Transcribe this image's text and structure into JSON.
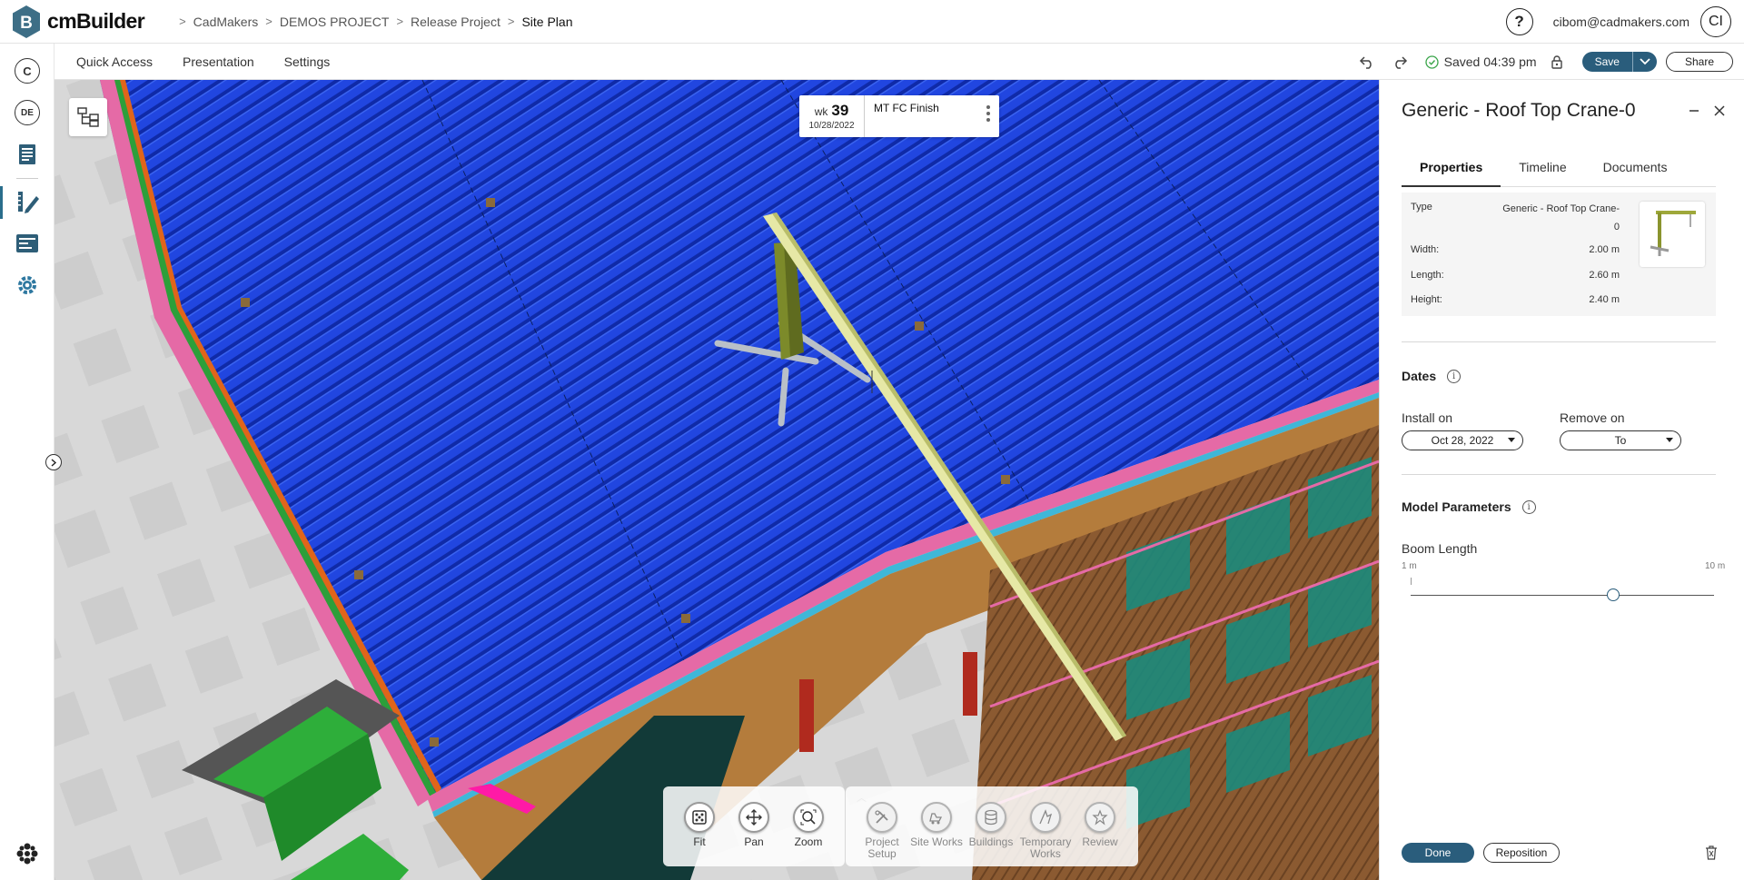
{
  "app": {
    "name": "cmBuilder",
    "logo_letter": "B"
  },
  "breadcrumb": [
    "CadMakers",
    "DEMOS PROJECT",
    "Release Project",
    "Site Plan"
  ],
  "header": {
    "help_label": "?",
    "user_email": "cibom@cadmakers.com",
    "avatar_initials": "CI"
  },
  "leftrail": {
    "org_initial": "C",
    "project_initials": "DE"
  },
  "menu": [
    "Quick Access",
    "Presentation",
    "Settings"
  ],
  "status": {
    "saved_text": "Saved 04:39 pm"
  },
  "actions": {
    "save_label": "Save",
    "share_label": "Share"
  },
  "week_card": {
    "wk_label": "wk",
    "week_number": "39",
    "date": "10/28/2022",
    "title": "MT FC Finish"
  },
  "bottom_toolbar": {
    "navigation": [
      {
        "label": "Fit",
        "icon": "fit-icon"
      },
      {
        "label": "Pan",
        "icon": "pan-icon"
      },
      {
        "label": "Zoom",
        "icon": "zoom-icon"
      }
    ],
    "modes": [
      {
        "label": "Project Setup",
        "icon": "project-setup-icon"
      },
      {
        "label": "Site Works",
        "icon": "site-works-icon"
      },
      {
        "label": "Buildings",
        "icon": "buildings-icon"
      },
      {
        "label": "Temporary Works",
        "icon": "temporary-works-icon"
      },
      {
        "label": "Review",
        "icon": "review-icon"
      }
    ]
  },
  "panel": {
    "title": "Generic - Roof Top Crane-0",
    "tabs": [
      "Properties",
      "Timeline",
      "Documents"
    ],
    "active_tab": "Properties",
    "properties": {
      "type_label": "Type",
      "type_value": "Generic - Roof Top Crane-0",
      "width_label": "Width:",
      "width_value": "2.00 m",
      "length_label": "Length:",
      "length_value": "2.60 m",
      "height_label": "Height:",
      "height_value": "2.40 m"
    },
    "dates": {
      "title": "Dates",
      "install_label": "Install on",
      "install_value": "Oct 28, 2022",
      "remove_label": "Remove on",
      "remove_value": "To"
    },
    "model_params": {
      "title": "Model Parameters",
      "boom_label": "Boom Length",
      "min_label": "1 m",
      "max_label": "10 m",
      "min": 1,
      "max": 10,
      "value": 7.0
    },
    "done_label": "Done",
    "reposition_label": "Reposition"
  },
  "colors": {
    "accent": "#2a5d7c",
    "roof": "#1b3fd6",
    "facade": "#8a5a30"
  }
}
